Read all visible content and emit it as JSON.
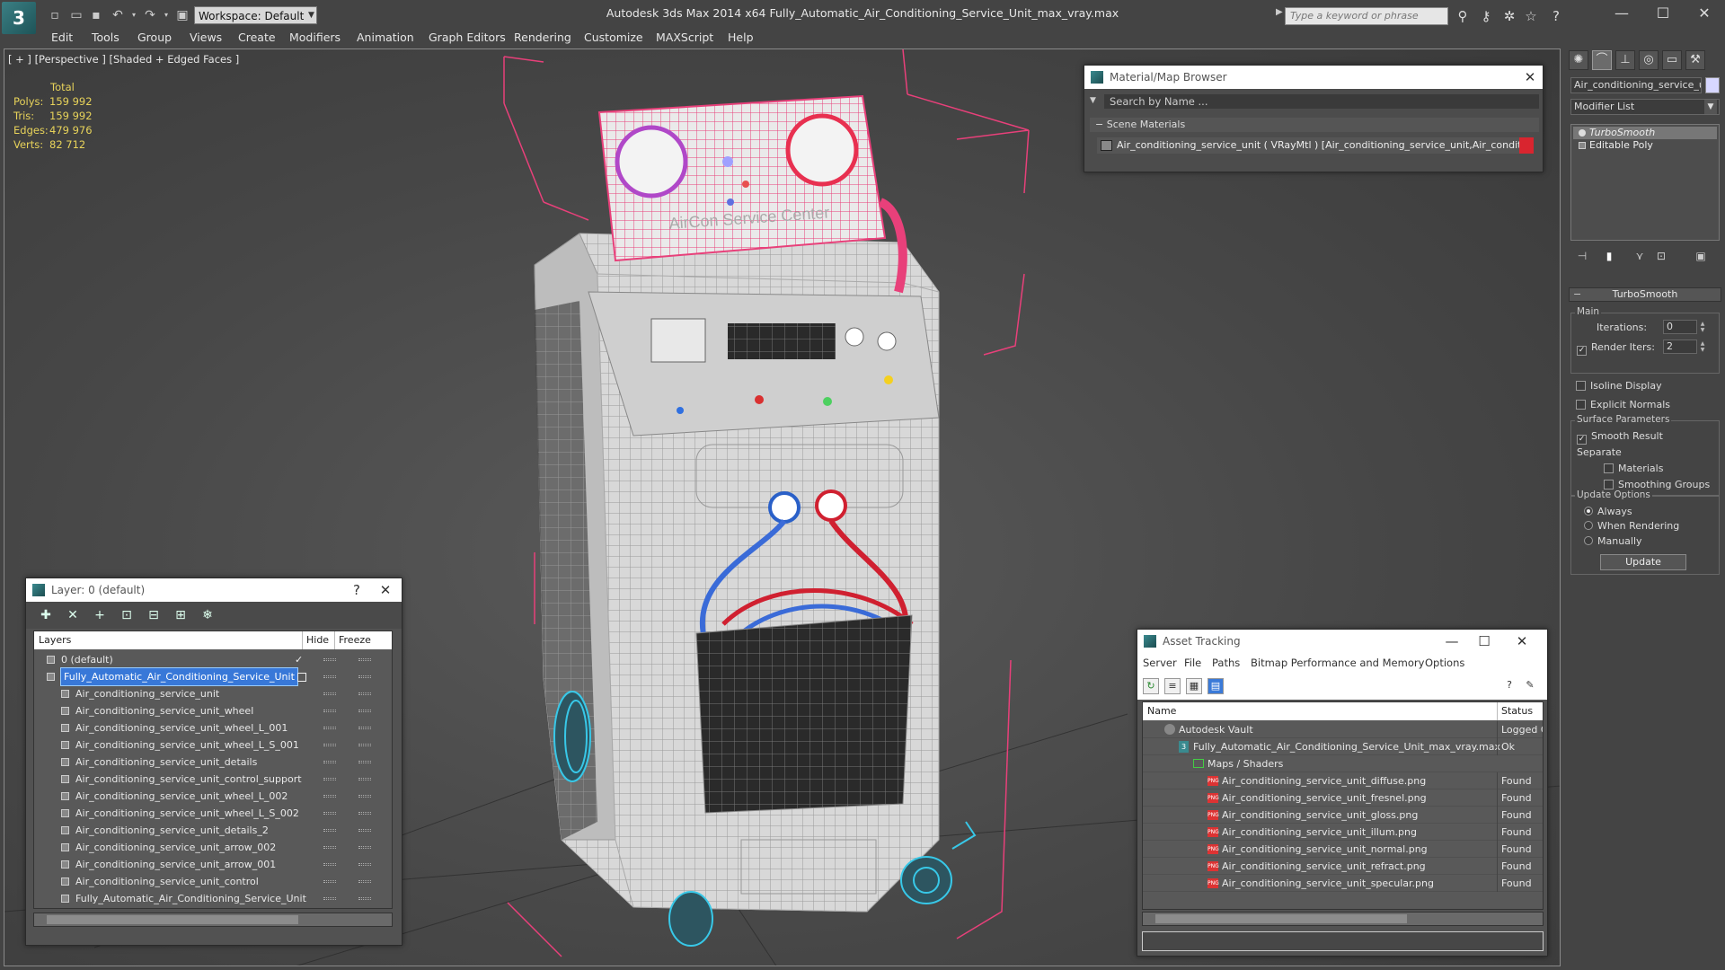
{
  "app": {
    "title": "Autodesk 3ds Max  2014 x64      Fully_Automatic_Air_Conditioning_Service_Unit_max_vray.max",
    "logo": "3",
    "workspace": "Workspace: Default",
    "search_placeholder": "Type a keyword or phrase"
  },
  "menu": [
    "Edit",
    "Tools",
    "Group",
    "Views",
    "Create",
    "Modifiers",
    "Animation",
    "Graph Editors",
    "Rendering",
    "Customize",
    "MAXScript",
    "Help"
  ],
  "viewport": {
    "label": "[ + ] [Perspective ] [Shaded + Edged Faces ]",
    "stats_title": "Total",
    "stats": [
      {
        "label": "Polys:",
        "value": "159 992"
      },
      {
        "label": "Tris:",
        "value": "159 992"
      },
      {
        "label": "Edges:",
        "value": "479 976"
      },
      {
        "label": "Verts:",
        "value": "82 712"
      }
    ],
    "panel_text": "AirCon Service Center"
  },
  "material_browser": {
    "title": "Material/Map Browser",
    "search_placeholder": "Search by Name ...",
    "section": "Scene Materials",
    "item": "Air_conditioning_service_unit ( VRayMtl ) [Air_conditioning_service_unit,Air_conditioni..."
  },
  "layer_manager": {
    "title": "Layer: 0 (default)",
    "help": "?",
    "columns": {
      "layers": "Layers",
      "hide": "Hide",
      "freeze": "Freeze"
    },
    "rows": [
      {
        "name": "0 (default)",
        "level": 0,
        "type": "layer",
        "current": true
      },
      {
        "name": "Fully_Automatic_Air_Conditioning_Service_Unit",
        "level": 0,
        "type": "layer",
        "selected": true
      },
      {
        "name": "Air_conditioning_service_unit",
        "level": 1,
        "type": "object"
      },
      {
        "name": "Air_conditioning_service_unit_wheel",
        "level": 1,
        "type": "object"
      },
      {
        "name": "Air_conditioning_service_unit_wheel_L_001",
        "level": 1,
        "type": "object"
      },
      {
        "name": "Air_conditioning_service_unit_wheel_L_S_001",
        "level": 1,
        "type": "object"
      },
      {
        "name": "Air_conditioning_service_unit_details",
        "level": 1,
        "type": "object"
      },
      {
        "name": "Air_conditioning_service_unit_control_support",
        "level": 1,
        "type": "object"
      },
      {
        "name": "Air_conditioning_service_unit_wheel_L_002",
        "level": 1,
        "type": "object"
      },
      {
        "name": "Air_conditioning_service_unit_wheel_L_S_002",
        "level": 1,
        "type": "object"
      },
      {
        "name": "Air_conditioning_service_unit_details_2",
        "level": 1,
        "type": "object"
      },
      {
        "name": "Air_conditioning_service_unit_arrow_002",
        "level": 1,
        "type": "object"
      },
      {
        "name": "Air_conditioning_service_unit_arrow_001",
        "level": 1,
        "type": "object"
      },
      {
        "name": "Air_conditioning_service_unit_control",
        "level": 1,
        "type": "object"
      },
      {
        "name": "Fully_Automatic_Air_Conditioning_Service_Unit",
        "level": 1,
        "type": "object"
      }
    ]
  },
  "asset_tracking": {
    "title": "Asset Tracking",
    "menu": [
      "Server",
      "File",
      "Paths",
      "Bitmap Performance and Memory",
      "Options"
    ],
    "columns": {
      "name": "Name",
      "status": "Status"
    },
    "rows": [
      {
        "name": "Autodesk Vault",
        "status": "Logged Out",
        "level": 0,
        "icon": "vault"
      },
      {
        "name": "Fully_Automatic_Air_Conditioning_Service_Unit_max_vray.max",
        "status": "Ok",
        "level": 1,
        "icon": "max"
      },
      {
        "name": "Maps / Shaders",
        "status": "",
        "level": 2,
        "icon": "folder"
      },
      {
        "name": "Air_conditioning_service_unit_diffuse.png",
        "status": "Found",
        "level": 3,
        "icon": "png"
      },
      {
        "name": "Air_conditioning_service_unit_fresnel.png",
        "status": "Found",
        "level": 3,
        "icon": "png"
      },
      {
        "name": "Air_conditioning_service_unit_gloss.png",
        "status": "Found",
        "level": 3,
        "icon": "png"
      },
      {
        "name": "Air_conditioning_service_unit_illum.png",
        "status": "Found",
        "level": 3,
        "icon": "png"
      },
      {
        "name": "Air_conditioning_service_unit_normal.png",
        "status": "Found",
        "level": 3,
        "icon": "png"
      },
      {
        "name": "Air_conditioning_service_unit_refract.png",
        "status": "Found",
        "level": 3,
        "icon": "png"
      },
      {
        "name": "Air_conditioning_service_unit_specular.png",
        "status": "Found",
        "level": 3,
        "icon": "png"
      }
    ]
  },
  "command_panel": {
    "object_name": "Air_conditioning_service_unit",
    "modifier_list": "Modifier List",
    "stack": [
      "TurboSmooth",
      "Editable Poly"
    ],
    "turbosmooth": {
      "header": "TurboSmooth",
      "main": "Main",
      "iterations_label": "Iterations:",
      "iterations": "0",
      "render_iters_label": "Render Iters:",
      "render_iters": "2",
      "isoline": "Isoline Display",
      "explicit_normals": "Explicit Normals",
      "surface_params": "Surface Parameters",
      "smooth_result": "Smooth Result",
      "separate": "Separate",
      "materials": "Materials",
      "smoothing_groups": "Smoothing Groups",
      "update_options": "Update Options",
      "always": "Always",
      "when_rendering": "When Rendering",
      "manually": "Manually",
      "update": "Update"
    }
  },
  "colors": {
    "selection": "#3878d8",
    "bbox": "#e8407a",
    "wheels": "#38c8e8",
    "material_highlight": "#d9252f"
  }
}
